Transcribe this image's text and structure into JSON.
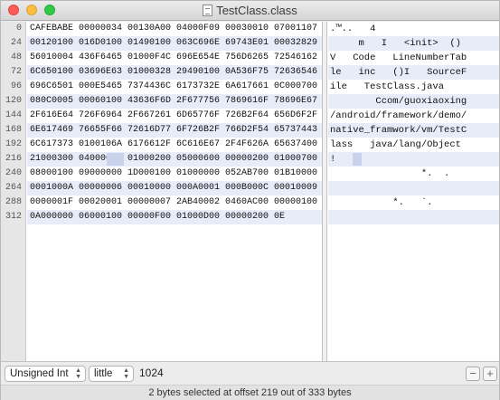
{
  "window": {
    "title": "TestClass.class"
  },
  "offsets": [
    "0",
    "24",
    "48",
    "72",
    "96",
    "120",
    "144",
    "168",
    "192",
    "216",
    "240",
    "264",
    "288",
    "312"
  ],
  "hex_rows": [
    "CAFEBABE 00000034 00130A00 04000F09 00030010 07001107",
    "00120100 016D0100 01490100 063C696E 69743E01 00032829",
    "56010004 436F6465 01000F4C 696E654E 756D6265 72546162",
    "6C650100 03696E63 01000328 29490100 0A536F75 72636546",
    "696C6501 000E5465 7374436C 6173732E 6A617661 0C000700",
    "080C0005 00060100 43636F6D 2F677756 7869616F 78696E67",
    "2F616E64 726F6964 2F667261 6D65776F 726B2F64 656D6F2F",
    "6E617469 76655F66 72616D77 6F726B2F 766D2F54 65737443",
    "6C617373 0100106A 6176612F 6C616E67 2F4F626A 65637400",
    "21000300 04000000 01000200 05000600 00000200 01000700",
    "08000100 09000000 1D000100 01000000 052AB700 01B10000",
    "0001000A 00000006 00010000 000A0001 000B000C 00010009",
    "0000001F 00020001 00000007 2AB40002 0460AC00 00000100",
    "0A000000 06000100 00000F00 01000D00 00000200 0E"
  ],
  "text_rows": [
    ".™..   4",
    "     m   I   <init>  ()",
    "V   Code   LineNumberTab",
    "le   inc   ()I   SourceF",
    "ile   TestClass.java",
    "        Ccom/guoxiaoxing",
    "/android/framework/demo/",
    "native_framwork/vm/TestC",
    "lass   java/lang/Object",
    "!",
    "                *.  .",
    "",
    "           *.   `.",
    ""
  ],
  "bottom": {
    "type_select": "Unsigned Int",
    "endian_select": "little",
    "value": "1024",
    "minus_label": "−",
    "plus_label": "+"
  },
  "status": "2 bytes selected at offset 219 out of 333 bytes"
}
